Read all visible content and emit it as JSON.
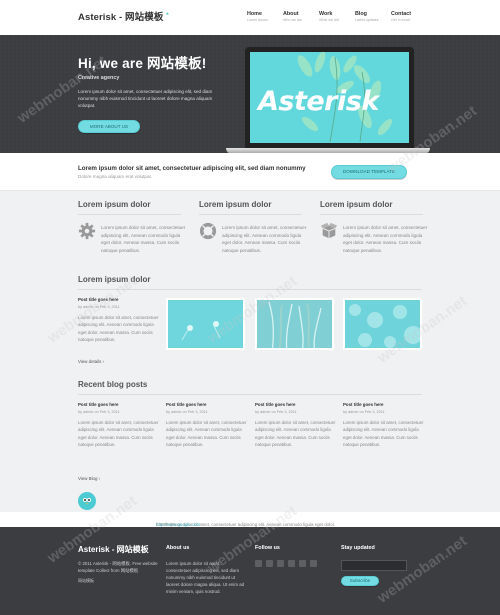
{
  "header": {
    "logo": "Asterisk - 网站模板",
    "logo_star": "*",
    "nav": [
      {
        "label": "Home",
        "sub": "Lorem ipsum"
      },
      {
        "label": "About",
        "sub": "Who we are"
      },
      {
        "label": "Work",
        "sub": "What we did"
      },
      {
        "label": "Blog",
        "sub": "Latest updates"
      },
      {
        "label": "Contact",
        "sub": "Get in touch"
      }
    ]
  },
  "hero": {
    "title": "Hi, we are 网站模板!",
    "subtitle": "Creative agency",
    "text": "Lorem ipsum dolor sit amet, consectetuer adipiscing elit, sed diam nonummy nibh euismod tincidunt ut laoreet dolore magna aliquam volutpat.",
    "button": "MORE ABOUT US",
    "screen_word": "Asterisk"
  },
  "tagline": {
    "main": "Lorem ipsum dolor sit amet, consectetuer adipiscing elit, sed diam nonummy",
    "sub": "Dolore magna aliquam erat volutpat.",
    "button": "DOWNLOAD TEMPLATE"
  },
  "features": [
    {
      "title": "Lorem ipsum dolor",
      "icon": "gear-icon",
      "text": "Lorem ipsum dolor sit amet, consectetuer adipiscing elit. Aenean commodo ligula eget dolor. Aenean massa. Cum sociis natoque penatibus."
    },
    {
      "title": "Lorem ipsum dolor",
      "icon": "lifebuoy-icon",
      "text": "Lorem ipsum dolor sit amet, consectetuer adipiscing elit. Aenean commodo ligula eget dolor. Aenean massa. Cum sociis natoque penatibus."
    },
    {
      "title": "Lorem ipsum dolor",
      "icon": "box-icon",
      "text": "Lorem ipsum dolor sit amet, consectetuer adipiscing elit. Aenean commodo ligula eget dolor. Aenean massa. Cum sociis natoque penatibus."
    }
  ],
  "portfolio": {
    "title": "Lorem ipsum dolor",
    "item_title": "Post title goes here",
    "item_meta": "by admin on Feb 3, 2011",
    "item_text": "Lorem ipsum dolor sit amet, consectetuer adipiscing elit. Aenean commodo ligula eget dolor. Aenean massa. Cum sociis natoque penatibus.",
    "view_details": "View details ›"
  },
  "blog": {
    "title": "Recent blog posts",
    "posts": [
      {
        "title": "Post title goes here",
        "meta": "by admin on Feb 3, 2011",
        "text": "Lorem ipsum dolor sit amet, consectetuer adipiscing elit. Aenean commodo ligula eget dolor. Aenean massa. Cum sociis natoque penatibus."
      },
      {
        "title": "Post title goes here",
        "meta": "by admin on Feb 3, 2011",
        "text": "Lorem ipsum dolor sit amet, consectetuer adipiscing elit. Aenean commodo ligula eget dolor. Aenean massa. Cum sociis natoque penatibus."
      },
      {
        "title": "Post title goes here",
        "meta": "by admin on Feb 3, 2011",
        "text": "Lorem ipsum dolor sit amet, consectetuer adipiscing elit. Aenean commodo ligula eget dolor. Aenean massa. Cum sociis natoque penatibus."
      },
      {
        "title": "Post title goes here",
        "meta": "by admin on Feb 3, 2011",
        "text": "Lorem ipsum dolor sit amet, consectetuer adipiscing elit. Aenean commodo ligula eget dolor. Aenean massa. Cum sociis natoque penatibus."
      }
    ],
    "view_blog": "View Blog ›"
  },
  "tweet": {
    "text": "Lorem ipsum dolor sit amet, consectetuer adipiscing elit. Aenean commodo ligula eget dolor.",
    "link": "http://www.google.com",
    "time": "2 hours ago"
  },
  "footer": {
    "logo": "Asterisk - 网站模板",
    "copyright": "© 2011 Asterisk - 网站模板. Free website template Collect from 网站模板",
    "copyright2": "网站模板",
    "about_title": "About us",
    "about_text": "Lorem ipsum dolor sit amet, consectetuer adipiscing elit, sed diam nonummy nibh euismod tincidunt ut laoreet dolore magna aliqua. Ut enim ad minim veniam, quis nostrud.",
    "follow_title": "Follow us",
    "social": [
      "facebook-icon",
      "twitter-icon",
      "skype-icon",
      "linkedin-icon",
      "vimeo-icon",
      "rss-icon"
    ],
    "stay_title": "Stay updated",
    "subscribe": "Subscribe"
  },
  "watermark": "webmoban.net",
  "colors": {
    "accent": "#72dce2",
    "dark": "#3c3d41",
    "light_bg": "#eff1f2"
  }
}
